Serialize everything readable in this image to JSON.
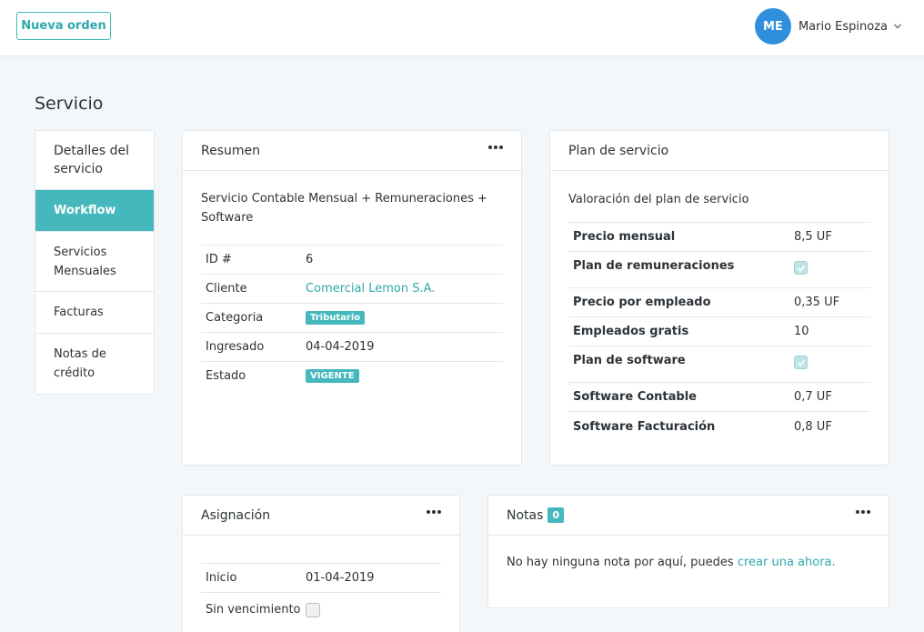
{
  "topbar": {
    "new_order_label": "Nueva orden",
    "user_initials": "ME",
    "user_name": "Mario Espinoza"
  },
  "page": {
    "title": "Servicio"
  },
  "sidenav": {
    "heading": "Detalles del servicio",
    "items": [
      {
        "label": "Workflow",
        "active": true
      },
      {
        "label": "Servicios Mensuales"
      },
      {
        "label": "Facturas"
      },
      {
        "label": "Notas de crédito"
      }
    ]
  },
  "resumen": {
    "title": "Resumen",
    "description": "Servicio Contable Mensual + Remuneraciones + Software",
    "rows": [
      {
        "key": "ID #",
        "value": "6"
      },
      {
        "key": "Cliente",
        "value": "Comercial Lemon S.A."
      },
      {
        "key": "Categoria",
        "value": "Tributario"
      },
      {
        "key": "Ingresado",
        "value": "04-04-2019"
      },
      {
        "key": "Estado",
        "value": "VIGENTE"
      }
    ]
  },
  "plan": {
    "title": "Plan de servicio",
    "subtitle": "Valoración del plan de servicio",
    "rows": [
      {
        "key": "Precio mensual",
        "value": "8,5 UF"
      },
      {
        "key": "Plan de remuneraciones",
        "checked": true
      },
      {
        "key": "Precio por empleado",
        "value": "0,35 UF"
      },
      {
        "key": "Empleados gratis",
        "value": "10"
      },
      {
        "key": "Plan de software",
        "checked": true
      },
      {
        "key": "Software Contable",
        "value": "0,7 UF"
      },
      {
        "key": "Software Facturación",
        "value": "0,8 UF"
      }
    ]
  },
  "asignacion": {
    "title": "Asignación",
    "rows": [
      {
        "key": "Inicio",
        "value": "01-04-2019"
      },
      {
        "key": "Sin vencimiento",
        "checked": false
      }
    ]
  },
  "notas": {
    "title": "Notas",
    "count": "0",
    "empty_text": "No hay ninguna nota por aquí, puedes ",
    "create_link": "crear una ahora."
  },
  "colors": {
    "accent": "#44b8bd",
    "avatar": "#2f8fdc"
  }
}
